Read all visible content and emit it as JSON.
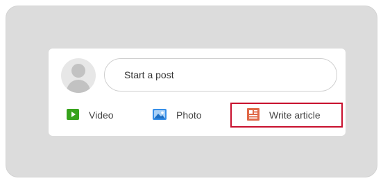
{
  "composer": {
    "placeholder": "Start a post",
    "actions": [
      {
        "label": "Video",
        "icon": "video-icon",
        "color": "#37a31c"
      },
      {
        "label": "Photo",
        "icon": "photo-icon",
        "color": "#378fe9"
      },
      {
        "label": "Write article",
        "icon": "article-icon",
        "color": "#e06847",
        "highlighted": true,
        "highlight_color": "#c8102e"
      }
    ]
  }
}
